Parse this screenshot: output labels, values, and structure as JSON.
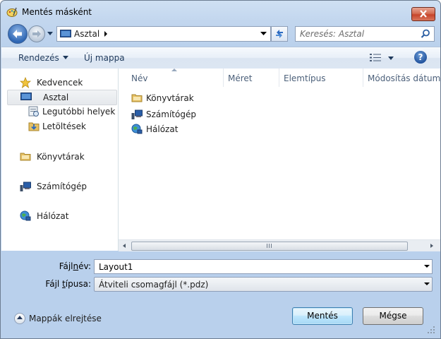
{
  "window": {
    "title": "Mentés másként"
  },
  "address_bar": {
    "location": "Asztal"
  },
  "search": {
    "placeholder": "Keresés: Asztal"
  },
  "toolbar": {
    "organize_label": "Rendezés",
    "new_folder_label": "Új mappa",
    "help_label": "?"
  },
  "nav": {
    "favorites_label": "Kedvencek",
    "favorites_items": [
      {
        "label": "Asztal",
        "icon": "desktop-icon",
        "selected": true
      },
      {
        "label": "Legutóbbi helyek",
        "icon": "recent-places-icon",
        "selected": false
      },
      {
        "label": "Letöltések",
        "icon": "downloads-icon",
        "selected": false
      }
    ],
    "libraries_label": "Könyvtárak",
    "computer_label": "Számítógép",
    "network_label": "Hálózat"
  },
  "file_list": {
    "columns": [
      "Név",
      "Méret",
      "Elemtípus",
      "Módosítás dátuma"
    ],
    "items": [
      {
        "label": "Könyvtárak",
        "icon": "libraries-icon"
      },
      {
        "label": "Számítógép",
        "icon": "computer-icon"
      },
      {
        "label": "Hálózat",
        "icon": "network-icon"
      }
    ]
  },
  "form": {
    "filename_label_pre": "Fájl",
    "filename_label_underline": "n",
    "filename_label_post": "év:",
    "filename_value": "Layout1",
    "filetype_label_pre": "Fájl ",
    "filetype_label_underline": "t",
    "filetype_label_post": "ípusa:",
    "filetype_value": "Átviteli csomagfájl (*.pdz)"
  },
  "footer": {
    "hide_folders_label": "Mappák elrejtése",
    "save_label": "Mentés",
    "cancel_label": "Mégse"
  },
  "colors": {
    "title_gradient": "#c2d6ee",
    "selection": "#e5e8ec",
    "default_button": "#3c7fb1"
  }
}
